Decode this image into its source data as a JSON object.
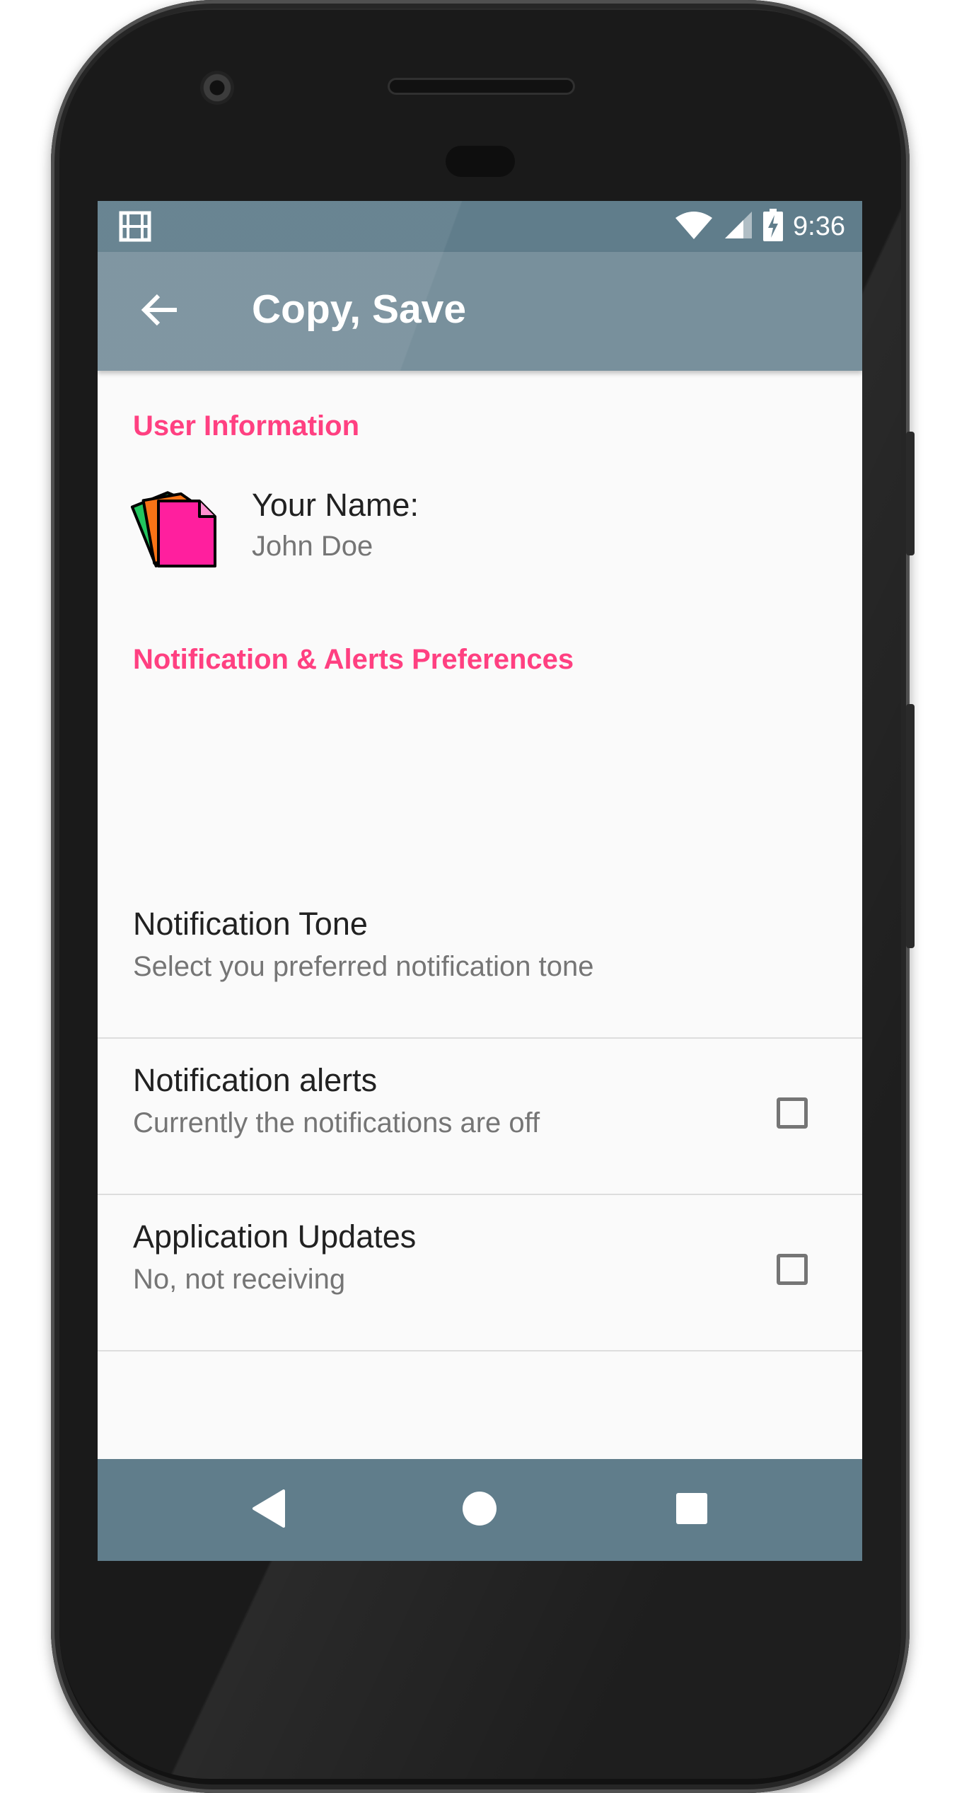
{
  "status_bar": {
    "time": "9:36",
    "left_icon": "film-icon",
    "right_icons": [
      "wifi-icon",
      "signal-icon",
      "battery-charging-icon"
    ]
  },
  "app_bar": {
    "title": "Copy, Save",
    "nav_icon": "back-arrow-icon"
  },
  "sections": {
    "user_information": {
      "header": "User Information",
      "item": {
        "icon": "pages-stack-icon",
        "title": "Your Name:",
        "summary": "John Doe"
      }
    },
    "notifications": {
      "header": "Notification & Alerts Preferences",
      "items": [
        {
          "title": "Notification Tone",
          "summary": "Select you preferred notification tone",
          "has_checkbox": false
        },
        {
          "title": "Notification alerts",
          "summary": "Currently the notifications are off",
          "has_checkbox": true,
          "checked": false
        },
        {
          "title": "Application Updates",
          "summary": "No, not receiving",
          "has_checkbox": true,
          "checked": false
        }
      ]
    }
  },
  "nav_bar": {
    "buttons": [
      "back-triangle-icon",
      "home-circle-icon",
      "recents-square-icon"
    ]
  },
  "colors": {
    "status_bar": "#607d8b",
    "app_bar": "#78909c",
    "accent": "#ff4081",
    "background": "#fafafa",
    "primary_text": "#212121",
    "secondary_text": "#757575"
  }
}
